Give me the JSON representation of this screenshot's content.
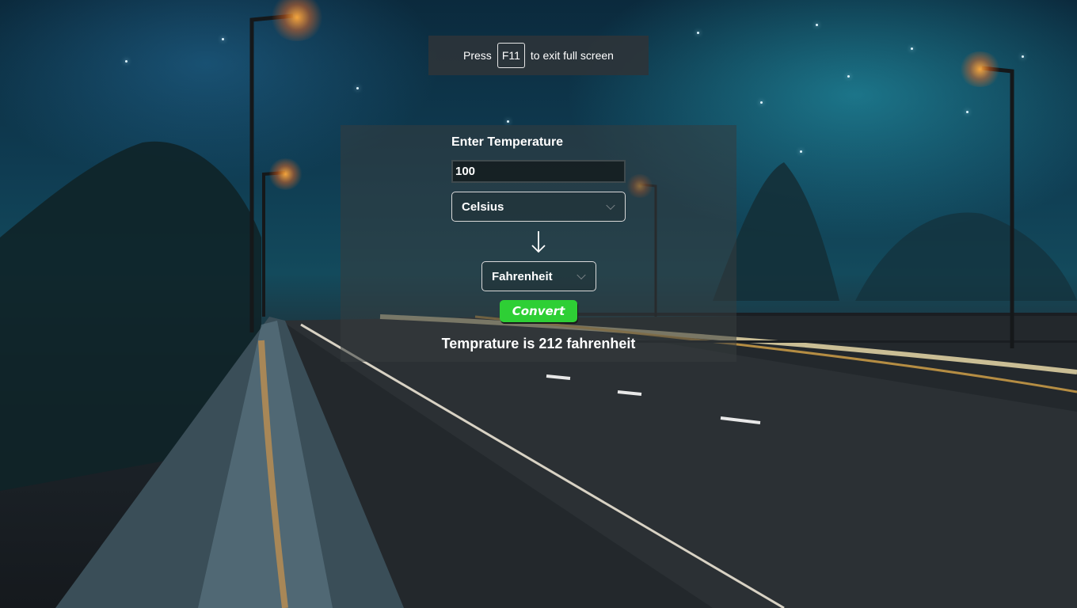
{
  "fullscreen_hint": {
    "prefix": "Press",
    "key": "F11",
    "suffix": "to exit full screen"
  },
  "converter": {
    "heading": "Enter Temperature",
    "input_value": "100",
    "from_unit": "Celsius",
    "to_unit": "Fahrenheit",
    "convert_label": "Convert",
    "result": "Temprature is 212 fahrenheit"
  },
  "icons": {
    "direction": "arrow-down-icon",
    "dropdown": "chevron-down-icon"
  }
}
